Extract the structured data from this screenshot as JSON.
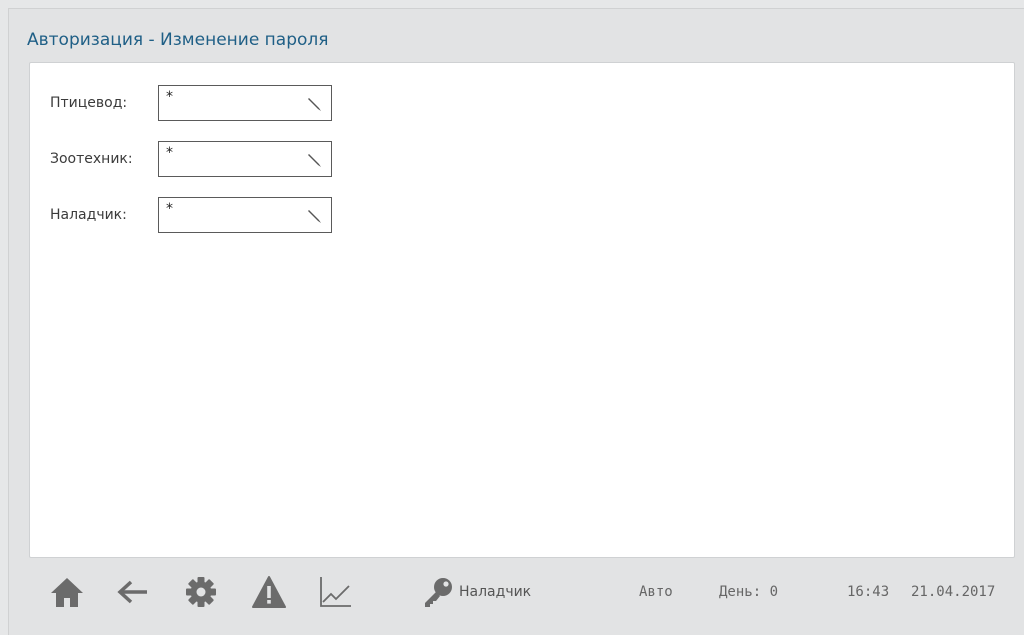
{
  "window": {
    "title": "Авторизация - Изменение пароля"
  },
  "form": {
    "fields": [
      {
        "label": "Птицевод:",
        "value": "*",
        "icon": "pencil-icon"
      },
      {
        "label": "Зоотехник:",
        "value": "*",
        "icon": "pencil-icon"
      },
      {
        "label": "Наладчик:",
        "value": "*",
        "icon": "pencil-icon"
      }
    ]
  },
  "footer": {
    "icons": [
      "home-icon",
      "back-arrow-icon",
      "gear-icon",
      "warning-icon",
      "chart-icon",
      "key-icon"
    ],
    "user": "Наладчик",
    "mode": "Авто",
    "day": "День: 0",
    "time": "16:43",
    "date": "21.04.2017"
  },
  "colors": {
    "title": "#1f5f86",
    "icons": "#6b6b6b",
    "background": "#e2e3e4"
  }
}
